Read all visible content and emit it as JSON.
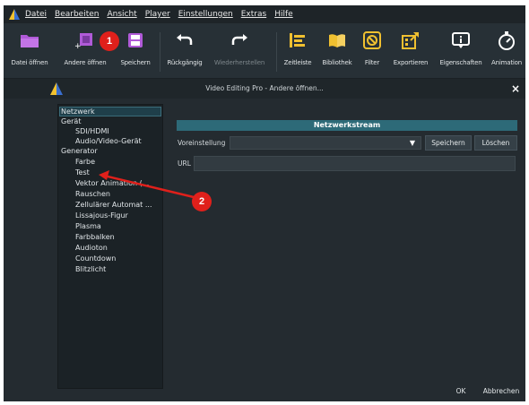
{
  "menubar": {
    "items": [
      "Datei",
      "Bearbeiten",
      "Ansicht",
      "Player",
      "Einstellungen",
      "Extras",
      "Hilfe"
    ]
  },
  "toolbar": {
    "buttons": [
      {
        "label": "Datei öffnen",
        "icon": "folder-icon"
      },
      {
        "label": "Andere öffnen",
        "icon": "open-other-icon"
      },
      {
        "label": "Speichern",
        "icon": "save-icon"
      },
      {
        "label": "Rückgängig",
        "icon": "undo-icon"
      },
      {
        "label": "Wiederherstellen",
        "icon": "redo-icon",
        "disabled": true
      },
      {
        "label": "Zeitleiste",
        "icon": "timeline-icon"
      },
      {
        "label": "Bibliothek",
        "icon": "library-icon"
      },
      {
        "label": "Filter",
        "icon": "filter-icon"
      },
      {
        "label": "Exportieren",
        "icon": "export-icon"
      },
      {
        "label": "Eigenschaften",
        "icon": "properties-icon"
      },
      {
        "label": "Animation",
        "icon": "animation-icon"
      }
    ]
  },
  "dialog": {
    "title": "Video Editing Pro - Andere öffnen...",
    "close_label": "×",
    "tree": [
      "Netzwerk",
      "Gerät",
      "SDI/HDMI",
      "Audio/Video-Gerät",
      "Generator",
      "Farbe",
      "Test",
      "Vektor Animation (...",
      "Rauschen",
      "Zellulärer Automat ...",
      "Lissajous-Figur",
      "Plasma",
      "Farbbalken",
      "Audioton",
      "Countdown",
      "Blitzlicht"
    ],
    "section_title": "Netzwerkstream",
    "preset_label": "Voreinstellung",
    "preset_value": "",
    "save_button": "Speichern",
    "delete_button": "Löschen",
    "url_label": "URL",
    "url_value": "",
    "ok_button": "OK",
    "cancel_button": "Abbrechen"
  },
  "annotations": {
    "badge_1": "1",
    "badge_2": "2",
    "color": "#e0201b"
  },
  "colors": {
    "accent": "#2d6a78",
    "icon_purple": "#b05ad8",
    "annotation_red": "#e0201b"
  }
}
